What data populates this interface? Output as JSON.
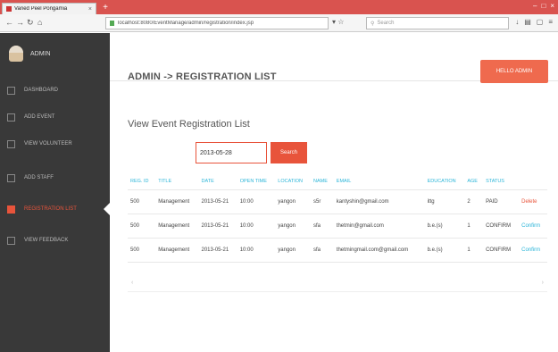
{
  "browser": {
    "tab_title": "Varied Peel Pongamia",
    "url": "localhost:8080/EventManage/admin/registration/index.jsp",
    "search_placeholder": "Search",
    "new_tab": "+",
    "winctl": [
      "–",
      "□",
      "×"
    ]
  },
  "sidebar": {
    "profile_name": "ADMIN",
    "items": [
      {
        "label": "DASHBOARD"
      },
      {
        "label": "ADD EVENT"
      },
      {
        "label": "VIEW VOLUNTEER"
      },
      {
        "label": "ADD STAFF"
      },
      {
        "label": "REGISTRATION LIST"
      },
      {
        "label": "VIEW FEEDBACK"
      }
    ]
  },
  "header": {
    "breadcrumb": "ADMIN -> REGISTRATION LIST",
    "top_button": "HELLO ADMIN"
  },
  "main": {
    "section_title": "View Event Registration List",
    "date_value": "2013-05-28",
    "search_button": "Search"
  },
  "table": {
    "columns": [
      "REG. ID",
      "TITLE",
      "DATE",
      "OPEN TIME",
      "LOCATION",
      "NAME",
      "EMAIL",
      "EDUCATION",
      "AGE",
      "STATUS",
      ""
    ],
    "rows": [
      [
        "500",
        "Management",
        "2013-05-21",
        "10:00",
        "yangon",
        "s5r",
        "kantyshin@gmail.com",
        "ittg",
        "2",
        "PAID",
        "Delete"
      ],
      [
        "500",
        "Management",
        "2013-05-21",
        "10:00",
        "yangon",
        "sfa",
        "thetmin@gmail.com",
        "b.e.(s)",
        "1",
        "CONFIRM",
        "Confirm"
      ],
      [
        "500",
        "Management",
        "2013-05-21",
        "10:00",
        "yangon",
        "sfa",
        "thetmingmail.com@gmail.com",
        "b.e.(s)",
        "1",
        "CONFIRM",
        "Confirm"
      ]
    ]
  },
  "colors": {
    "accent": "#e8543b",
    "sidebar_bg": "#393939",
    "link_blue": "#2bb5d8",
    "tabbar": "#d9534f"
  }
}
